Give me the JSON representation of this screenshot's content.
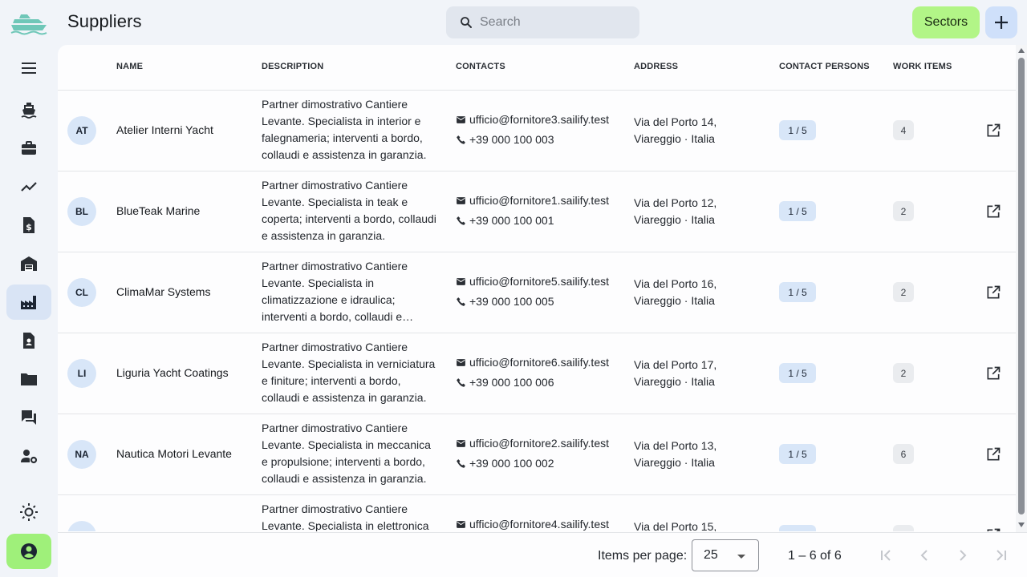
{
  "header": {
    "title": "Suppliers",
    "search_placeholder": "Search",
    "sectors_label": "Sectors"
  },
  "table": {
    "columns": [
      "Name",
      "Description",
      "Contacts",
      "Address",
      "Contact persons",
      "Work items"
    ],
    "rows": [
      {
        "initials": "AT",
        "name": "Atelier Interni Yacht",
        "description": "Partner dimostrativo Cantiere Levante. Specialista in interior e falegnameria; interventi a bordo, collaudi e assistenza in garanzia.",
        "email": "ufficio@fornitore3.sailify.test",
        "phone": "+39 000 100 003",
        "address": "Via del Porto 14, Viareggio · Italia",
        "contact_persons": "1 / 5",
        "work_items": "4"
      },
      {
        "initials": "BL",
        "name": "BlueTeak Marine",
        "description": "Partner dimostrativo Cantiere Levante. Specialista in teak e coperta; interventi a bordo, collaudi e assistenza in garanzia.",
        "email": "ufficio@fornitore1.sailify.test",
        "phone": "+39 000 100 001",
        "address": "Via del Porto 12, Viareggio · Italia",
        "contact_persons": "1 / 5",
        "work_items": "2"
      },
      {
        "initials": "CL",
        "name": "ClimaMar Systems",
        "description": "Partner dimostrativo Cantiere Levante. Specialista in climatizzazione e idraulica; interventi a bordo, collaudi e assistenza in garanzia.",
        "email": "ufficio@fornitore5.sailify.test",
        "phone": "+39 000 100 005",
        "address": "Via del Porto 16, Viareggio · Italia",
        "contact_persons": "1 / 5",
        "work_items": "2"
      },
      {
        "initials": "LI",
        "name": "Liguria Yacht Coatings",
        "description": "Partner dimostrativo Cantiere Levante. Specialista in verniciatura e finiture; interventi a bordo, collaudi e assistenza in garanzia.",
        "email": "ufficio@fornitore6.sailify.test",
        "phone": "+39 000 100 006",
        "address": "Via del Porto 17, Viareggio · Italia",
        "contact_persons": "1 / 5",
        "work_items": "2"
      },
      {
        "initials": "NA",
        "name": "Nautica Motori Levante",
        "description": "Partner dimostrativo Cantiere Levante. Specialista in meccanica e propulsione; interventi a bordo, collaudi e assistenza in garanzia.",
        "email": "ufficio@fornitore2.sailify.test",
        "phone": "+39 000 100 002",
        "address": "Via del Porto 13, Viareggio · Italia",
        "contact_persons": "1 / 5",
        "work_items": "6"
      },
      {
        "initials": "",
        "name": "",
        "description": "Partner dimostrativo Cantiere Levante. Specialista in elettronica",
        "email": "ufficio@fornitore4.sailify.test",
        "phone": "",
        "address": "Via del Porto 15,",
        "contact_persons": "",
        "work_items": ""
      }
    ]
  },
  "paginator": {
    "items_per_page_label": "Items per page:",
    "page_size": "25",
    "range_label": "1 – 6 of 6"
  },
  "colors": {
    "accent_green": "#b2f587",
    "accent_blue": "#cfe0fa",
    "chip_blue": "#d8e6f8",
    "logo": "#6fc7b8"
  },
  "icons": {
    "logo": "ship-logo-icon",
    "nav": [
      "menu-icon",
      "ship-icon",
      "briefcase-icon",
      "trending-icon",
      "invoice-icon",
      "warehouse-icon",
      "factory-icon",
      "contact-card-icon",
      "folder-icon",
      "chat-icon",
      "user-settings-icon",
      "sun-icon",
      "account-circle-icon"
    ]
  }
}
